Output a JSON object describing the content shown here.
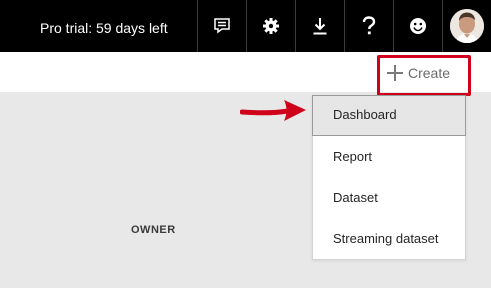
{
  "topbar": {
    "trial_text": "Pro trial: 59 days left",
    "icons": [
      "feedback-icon",
      "gear-icon",
      "download-icon",
      "help-icon",
      "smiley-icon",
      "avatar"
    ]
  },
  "create": {
    "label": "Create",
    "icon": "plus-icon",
    "highlight_color": "#d0021b"
  },
  "menu": {
    "items": [
      {
        "label": "Dashboard",
        "active": true
      },
      {
        "label": "Report"
      },
      {
        "label": "Dataset"
      },
      {
        "label": "Streaming dataset"
      }
    ]
  },
  "content": {
    "column_header": "OWNER"
  },
  "annotation": {
    "arrow_color": "#d0021b"
  }
}
